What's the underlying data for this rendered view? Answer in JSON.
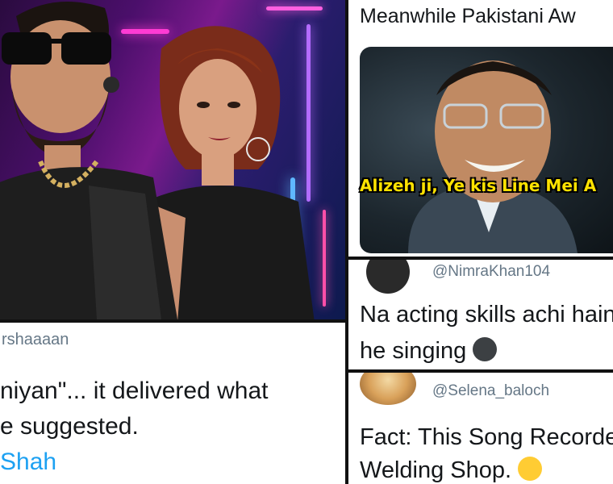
{
  "left_photo": {
    "description_icons": [
      "man-in-sunglasses",
      "woman-portrait"
    ]
  },
  "left_tweet": {
    "handle": "rshaaaan",
    "line1": "niyan\"... it delivered what",
    "line2": "e suggested.",
    "link": "Shah"
  },
  "meme": {
    "header": "Meanwhile Pakistani Aw",
    "caption": "Alizeh ji, Ye kis Line Mei A"
  },
  "tweet_mid": {
    "handle": "@NimraKhan104",
    "line1": "Na acting skills achi hain",
    "line2": "he singing"
  },
  "tweet_bot": {
    "handle": "@Selena_baloch",
    "line1": "Fact: This Song Recorde",
    "line2": "Welding Shop."
  }
}
